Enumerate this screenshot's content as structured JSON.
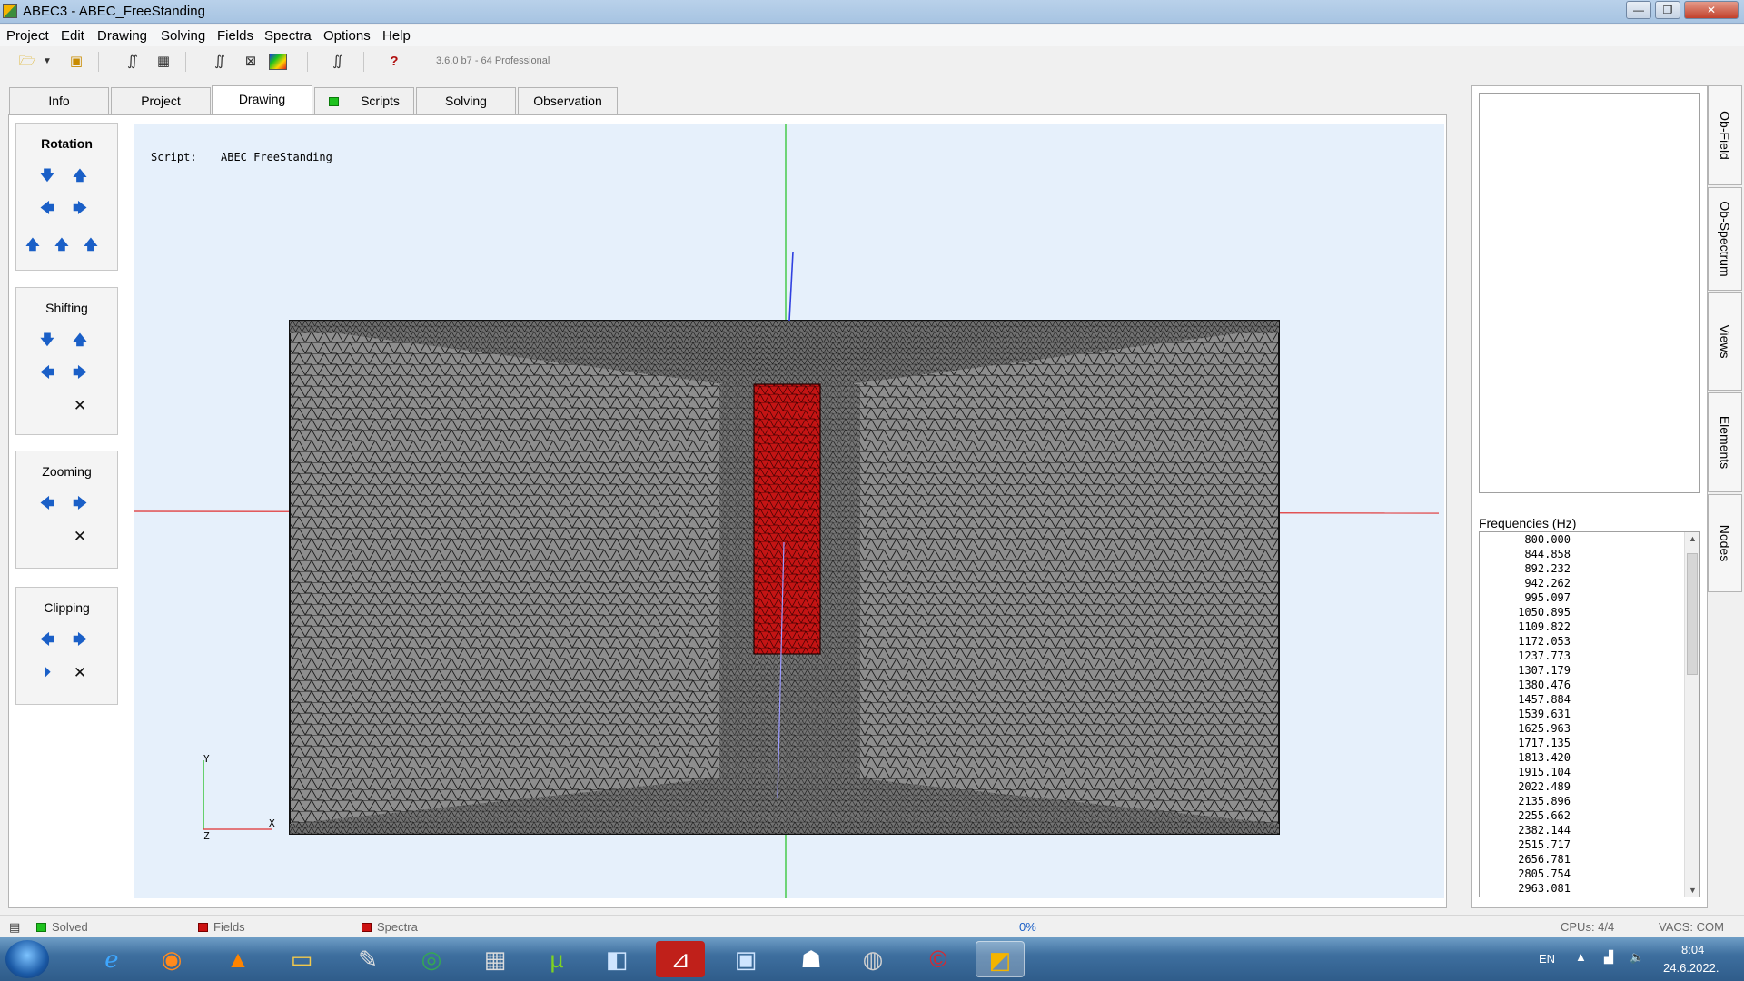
{
  "window": {
    "title": "ABEC3 - ABEC_FreeStanding",
    "minimize": "—",
    "maximize": "❐",
    "close": "✕"
  },
  "menu": [
    "Project",
    "Edit",
    "Drawing",
    "Solving",
    "Fields",
    "Spectra",
    "Options",
    "Help"
  ],
  "toolbar": {
    "version": "3.6.0 b7 - 64 Professional"
  },
  "tabs": [
    "Info",
    "Project",
    "Drawing",
    "Scripts",
    "Solving",
    "Observation"
  ],
  "controls": {
    "rotation": "Rotation",
    "shifting": "Shifting",
    "zooming": "Zooming",
    "clipping": "Clipping"
  },
  "viewport": {
    "script_label": "Script:",
    "script_name": "ABEC_FreeStanding",
    "axis_y": "Y",
    "axis_x": "X",
    "axis_z": "Z"
  },
  "side_tabs": [
    "Ob-Field",
    "Ob-Spectrum",
    "Views",
    "Elements",
    "Nodes"
  ],
  "frequencies": {
    "title": "Frequencies  (Hz)",
    "values": [
      "800.000",
      "844.858",
      "892.232",
      "942.262",
      "995.097",
      "1050.895",
      "1109.822",
      "1172.053",
      "1237.773",
      "1307.179",
      "1380.476",
      "1457.884",
      "1539.631",
      "1625.963",
      "1717.135",
      "1813.420",
      "1915.104",
      "2022.489",
      "2135.896",
      "2255.662",
      "2382.144",
      "2515.717",
      "2656.781",
      "2805.754",
      "2963.081"
    ]
  },
  "status": {
    "solved": "Solved",
    "fields": "Fields",
    "spectra": "Spectra",
    "progress": "0%",
    "cpus": "CPUs: 4/4",
    "vacs": "VACS: COM"
  },
  "tray": {
    "lang": "EN",
    "time": "8:04",
    "date": "24.6.2022."
  },
  "colors": {
    "accent_green": "#1ec21e",
    "accent_red": "#cc1111",
    "mesh_gray": "#8c8c8c",
    "mesh_red": "#c41414"
  }
}
